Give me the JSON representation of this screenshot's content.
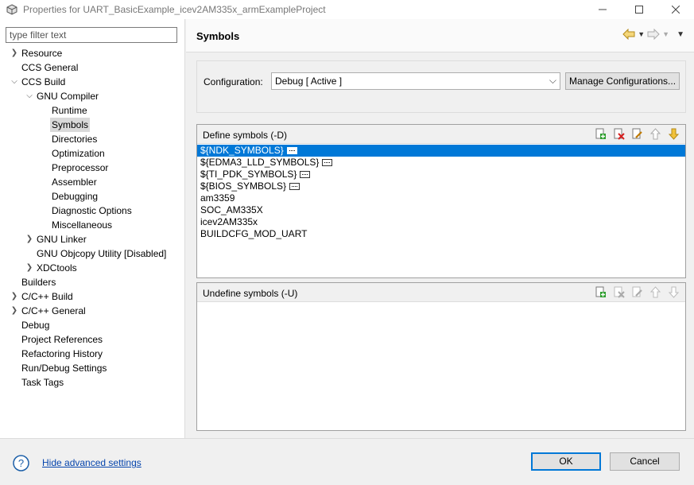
{
  "window": {
    "title": "Properties for UART_BasicExample_icev2AM335x_armExampleProject",
    "min_icon": "minimize-icon",
    "max_icon": "maximize-icon",
    "close_icon": "close-icon"
  },
  "filter": {
    "placeholder": "type filter text"
  },
  "tree": [
    {
      "label": "Resource",
      "twisty": ">"
    },
    {
      "label": "CCS General",
      "twisty": ""
    },
    {
      "label": "CCS Build",
      "twisty": "v"
    },
    {
      "label": "GNU Compiler",
      "twisty": "v"
    },
    {
      "label": "Runtime",
      "twisty": ""
    },
    {
      "label": "Symbols",
      "twisty": "",
      "selected": true
    },
    {
      "label": "Directories",
      "twisty": ""
    },
    {
      "label": "Optimization",
      "twisty": ""
    },
    {
      "label": "Preprocessor",
      "twisty": ""
    },
    {
      "label": "Assembler",
      "twisty": ""
    },
    {
      "label": "Debugging",
      "twisty": ""
    },
    {
      "label": "Diagnostic Options",
      "twisty": ""
    },
    {
      "label": "Miscellaneous",
      "twisty": ""
    },
    {
      "label": "GNU Linker",
      "twisty": ">"
    },
    {
      "label": "GNU Objcopy Utility  [Disabled]",
      "twisty": ""
    },
    {
      "label": "XDCtools",
      "twisty": ">"
    },
    {
      "label": "Builders",
      "twisty": ""
    },
    {
      "label": "C/C++ Build",
      "twisty": ">"
    },
    {
      "label": "C/C++ General",
      "twisty": ">"
    },
    {
      "label": "Debug",
      "twisty": ""
    },
    {
      "label": "Project References",
      "twisty": ""
    },
    {
      "label": "Refactoring History",
      "twisty": ""
    },
    {
      "label": "Run/Debug Settings",
      "twisty": ""
    },
    {
      "label": "Task Tags",
      "twisty": ""
    }
  ],
  "page": {
    "title": "Symbols"
  },
  "config": {
    "label": "Configuration:",
    "value": "Debug  [ Active ]",
    "manage_label": "Manage Configurations..."
  },
  "define": {
    "title": "Define symbols (-D)",
    "items": [
      {
        "text": "${NDK_SYMBOLS}",
        "dots": true,
        "selected": true
      },
      {
        "text": "${EDMA3_LLD_SYMBOLS}",
        "dots": true
      },
      {
        "text": "${TI_PDK_SYMBOLS}",
        "dots": true
      },
      {
        "text": "${BIOS_SYMBOLS}",
        "dots": true
      },
      {
        "text": "am3359"
      },
      {
        "text": "SOC_AM335X"
      },
      {
        "text": "icev2AM335x"
      },
      {
        "text": "BUILDCFG_MOD_UART"
      }
    ]
  },
  "undefine": {
    "title": "Undefine symbols (-U)",
    "items": []
  },
  "footer": {
    "help_link": "Hide advanced settings",
    "ok_label": "OK",
    "cancel_label": "Cancel"
  },
  "colors": {
    "selection": "#0078d7",
    "link": "#0645ad"
  }
}
